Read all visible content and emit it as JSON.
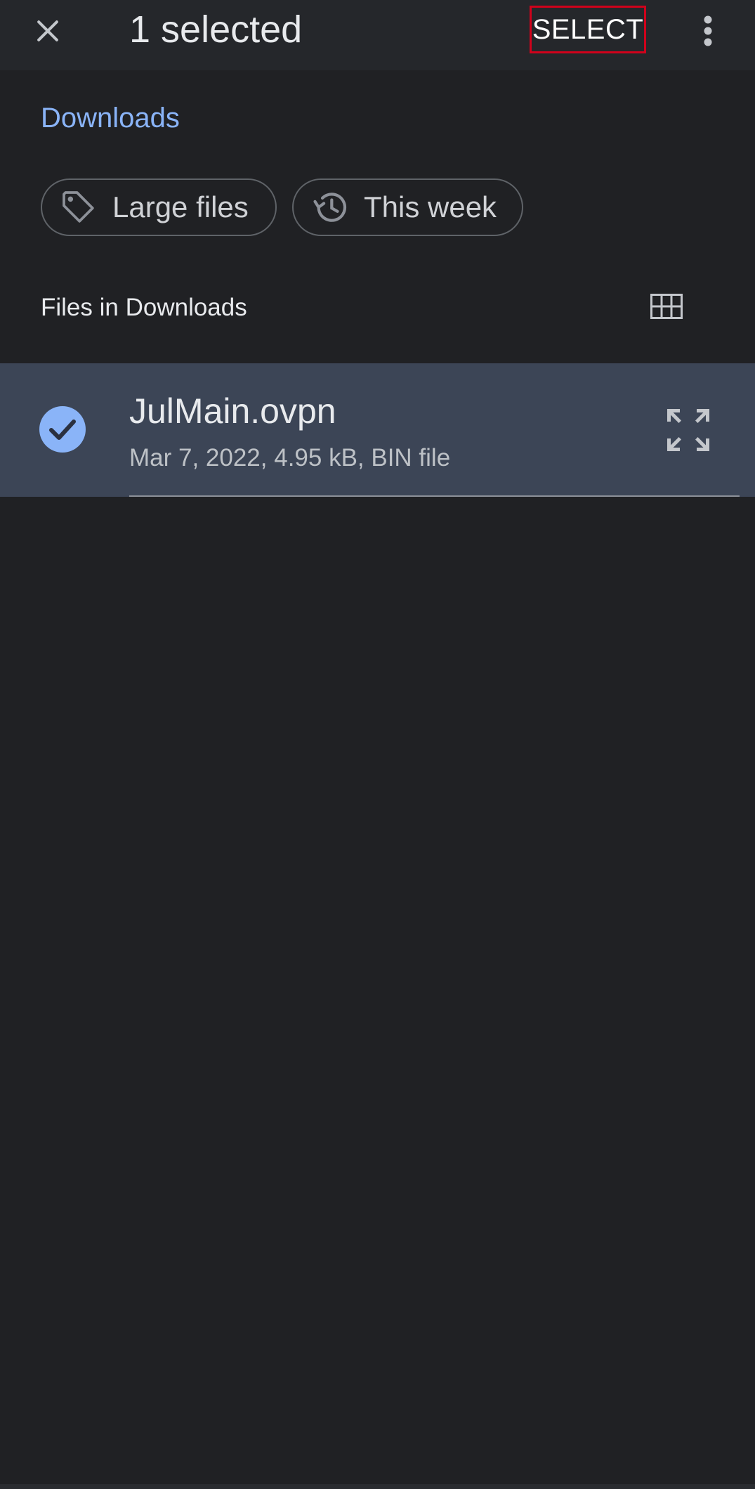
{
  "topbar": {
    "title": "1 selected",
    "select_label": "SELECT"
  },
  "breadcrumb": {
    "label": "Downloads"
  },
  "chips": [
    {
      "label": "Large files",
      "icon": "tag-icon"
    },
    {
      "label": "This week",
      "icon": "history-icon"
    }
  ],
  "section": {
    "title": "Files in Downloads",
    "view_icon": "grid-view-icon"
  },
  "files": [
    {
      "name": "JulMain.ovpn",
      "meta": "Mar 7, 2022, 4.95 kB, BIN file",
      "selected": true,
      "action_icon": "expand-icon"
    }
  ],
  "colors": {
    "background": "#202124",
    "accent": "#8ab4f8",
    "selected_row": "#3c4556",
    "highlight_border": "#d0021b"
  }
}
